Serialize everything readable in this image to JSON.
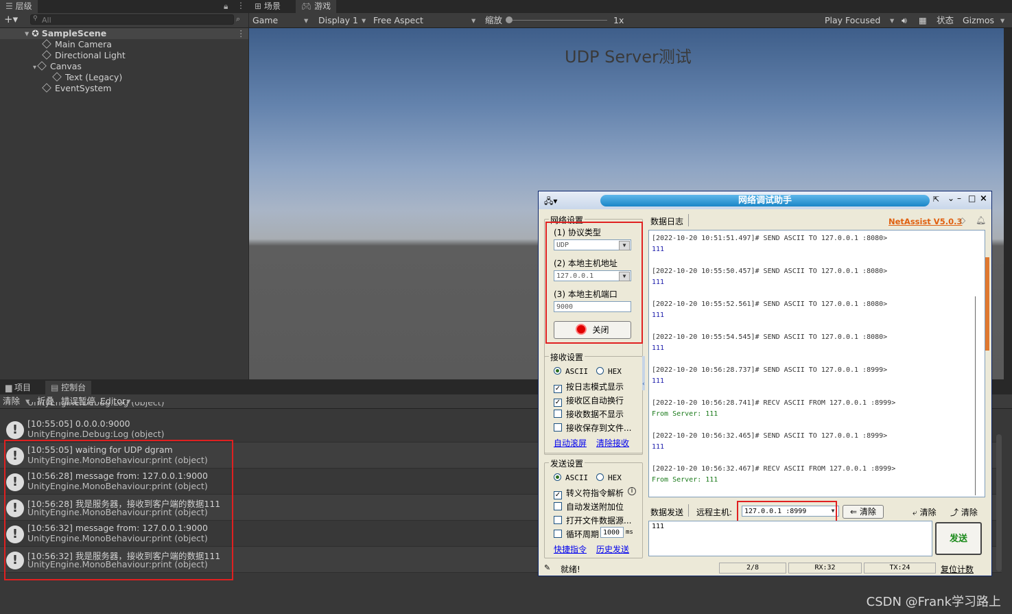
{
  "hierarchy": {
    "tab": "层级",
    "search_placeholder": "All",
    "scene": "SampleScene",
    "items": [
      {
        "label": "Main Camera"
      },
      {
        "label": "Directional Light"
      },
      {
        "label": "Canvas"
      },
      {
        "label": "Text (Legacy)"
      },
      {
        "label": "EventSystem"
      }
    ]
  },
  "game": {
    "tab_scene": "场景",
    "tab_game": "游戏",
    "mode": "Game",
    "display": "Display 1",
    "aspect": "Free Aspect",
    "scale_label": "缩放",
    "scale_value": "1x",
    "play_mode": "Play Focused",
    "stats": "状态",
    "gizmos": "Gizmos",
    "canvas_text": "UDP Server测试"
  },
  "console": {
    "tab_project": "项目",
    "tab_console": "控制台",
    "btn_clear": "清除",
    "btn_collapse": "折叠",
    "btn_error_pause": "错误暂停",
    "btn_editor": "Editor",
    "partial_line": "UnityEngine.Debug:Log (object)",
    "logs": [
      {
        "msg": "[10:55:05] 0.0.0.0:9000",
        "source": "UnityEngine.Debug:Log (object)"
      },
      {
        "msg": "[10:55:05] waiting for UDP dgram",
        "source": "UnityEngine.MonoBehaviour:print (object)"
      },
      {
        "msg": "[10:56:28] message from: 127.0.0.1:9000",
        "source": "UnityEngine.MonoBehaviour:print (object)"
      },
      {
        "msg": "[10:56:28] 我是服务器，接收到客户端的数据111",
        "source": "UnityEngine.MonoBehaviour:print (object)"
      },
      {
        "msg": "[10:56:32] message from: 127.0.0.1:9000",
        "source": "UnityEngine.MonoBehaviour:print (object)"
      },
      {
        "msg": "[10:56:32] 我是服务器，接收到客户端的数据111",
        "source": "UnityEngine.MonoBehaviour:print (object)"
      }
    ]
  },
  "netassist": {
    "title": "网络调试助手",
    "network_group": "网络设置",
    "protocol_label": "(1) 协议类型",
    "protocol_value": "UDP",
    "host_label": "(2) 本地主机地址",
    "host_value": "127.0.0.1",
    "port_label": "(3) 本地主机端口",
    "port_value": "9000",
    "close_button": "关闭",
    "recv_group": "接收设置",
    "recv_ascii": "ASCII",
    "recv_hex": "HEX",
    "recv_opt1": "按日志模式显示",
    "recv_opt2": "接收区自动换行",
    "recv_opt3": "接收数据不显示",
    "recv_opt4": "接收保存到文件...",
    "auto_scroll": "自动滚屏",
    "clear_recv": "清除接收",
    "send_group": "发送设置",
    "send_ascii": "ASCII",
    "send_hex": "HEX",
    "send_opt1": "转义符指令解析",
    "send_opt2": "自动发送附加位",
    "send_opt3": "打开文件数据源...",
    "send_opt4": "循环周期",
    "cycle_value": "1000",
    "cycle_unit": "ms",
    "shortcut": "快捷指令",
    "history": "历史发送",
    "log_tab": "数据日志",
    "brand": "NetAssist V5.0.3",
    "log_lines": [
      {
        "head": "[2022-10-20 10:51:51.497]# SEND ASCII TO 127.0.0.1 :8080>",
        "body": "111",
        "kind": "send"
      },
      {
        "head": "[2022-10-20 10:55:50.457]# SEND ASCII TO 127.0.0.1 :8080>",
        "body": "111",
        "kind": "send"
      },
      {
        "head": "[2022-10-20 10:55:52.561]# SEND ASCII TO 127.0.0.1 :8080>",
        "body": "111",
        "kind": "send"
      },
      {
        "head": "[2022-10-20 10:55:54.545]# SEND ASCII TO 127.0.0.1 :8080>",
        "body": "111",
        "kind": "send"
      },
      {
        "head": "[2022-10-20 10:56:28.737]# SEND ASCII TO 127.0.0.1 :8999>",
        "body": "111",
        "kind": "send"
      },
      {
        "head": "[2022-10-20 10:56:28.741]# RECV ASCII FROM 127.0.0.1 :8999>",
        "body": "From Server: 111",
        "kind": "recv"
      },
      {
        "head": "[2022-10-20 10:56:32.465]# SEND ASCII TO 127.0.0.1 :8999>",
        "body": "111",
        "kind": "send"
      },
      {
        "head": "[2022-10-20 10:56:32.467]# RECV ASCII FROM 127.0.0.1 :8999>",
        "body": "From Server: 111",
        "kind": "recv"
      }
    ],
    "send_tab": "数据发送",
    "remote_label": "远程主机:",
    "remote_value": "127.0.0.1 :8999",
    "clear1": "清除",
    "clear2": "清除",
    "clear3": "清除",
    "send_text": "111",
    "send_button": "发送",
    "status_ready": "就绪!",
    "status_count": "2/8",
    "status_rx": "RX:32",
    "status_tx": "TX:24",
    "reset_count": "复位计数"
  },
  "watermark": "CSDN @Frank学习路上",
  "colors": {
    "highlight": "#e02020",
    "send_text": "#1a1aaa",
    "recv_text": "#1a7a1a",
    "brand": "#e06010"
  }
}
